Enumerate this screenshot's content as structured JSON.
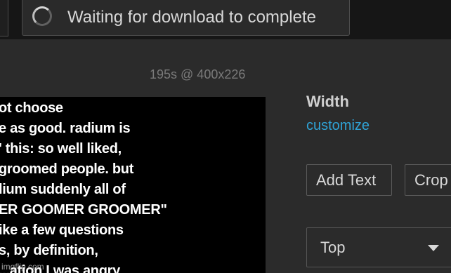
{
  "download": {
    "status_text": "Waiting for download to complete",
    "spinner_icon": "loading-spinner-icon"
  },
  "preview": {
    "info": "195s @ 400x226",
    "caption_lines": [
      "ot choose",
      "e as good. radium is",
      "' this: so well liked,",
      "groomed people. but",
      "lium suddenly all of",
      "ER GOOMER GROOMER\"",
      "ike a few questions",
      "s, by definition,",
      "...ation I was angry"
    ]
  },
  "settings": {
    "width_label": "Width",
    "customize_link": "customize",
    "add_text_button": "Add Text",
    "crop_button": "Crop",
    "position_select": {
      "selected": "Top",
      "icon": "chevron-down-icon"
    }
  },
  "watermark": "imgflip.com",
  "colors": {
    "background": "#2b2b2b",
    "topbar": "#161616",
    "link": "#2fa3d6"
  }
}
